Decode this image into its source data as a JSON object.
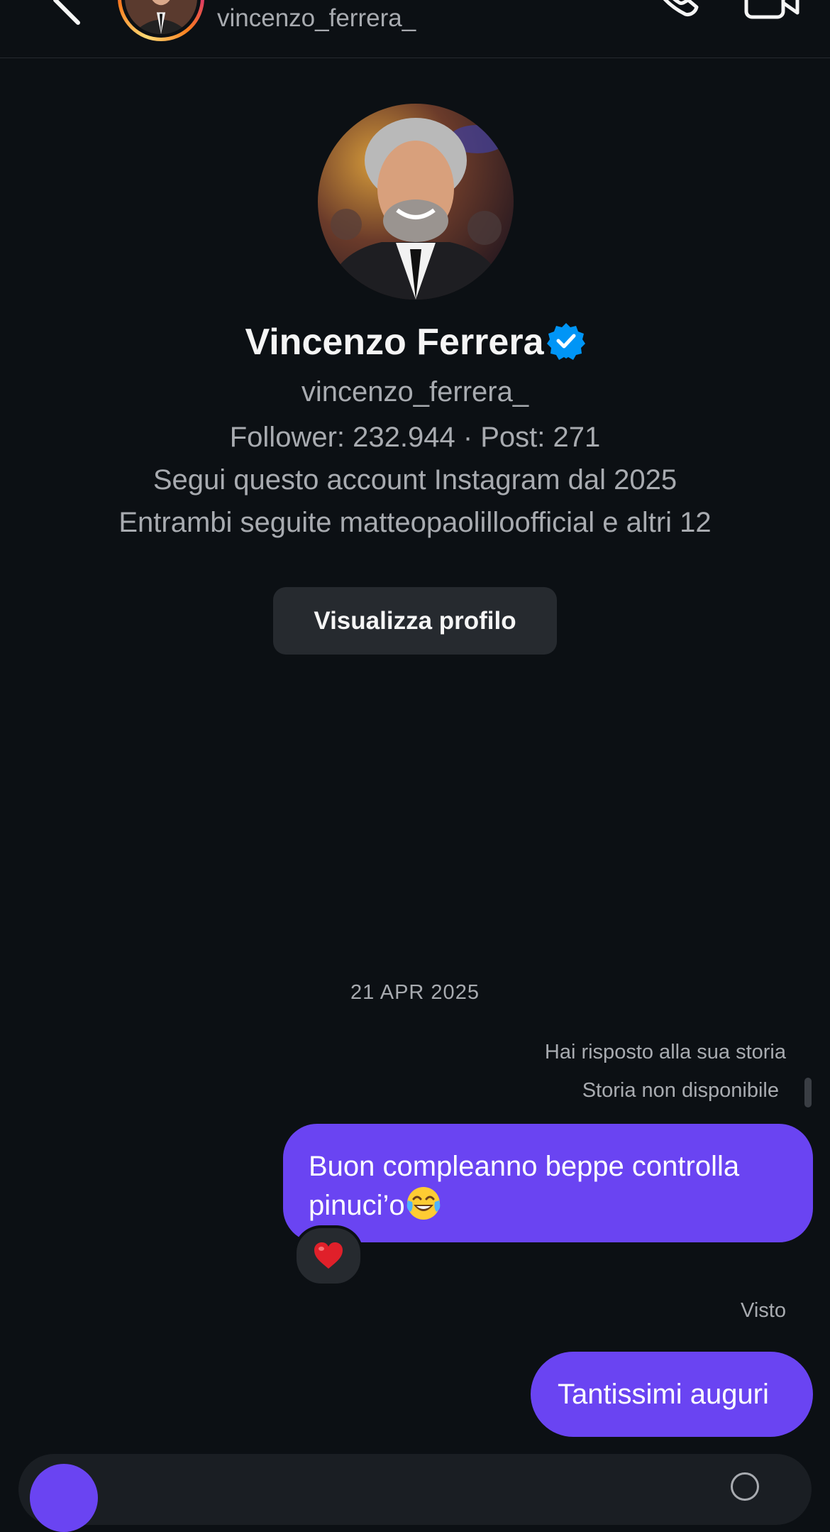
{
  "header": {
    "username": "vincenzo_ferrera_",
    "icons": {
      "back": "chevron-left-icon",
      "call": "phone-icon",
      "video": "video-camera-icon"
    }
  },
  "profile": {
    "display_name": "Vincenzo Ferrera",
    "verified": true,
    "username": "vincenzo_ferrera_",
    "stats": "Follower: 232.944 · Post: 271",
    "following_since": "Segui questo account Instagram dal 2025",
    "mutual": "Entrambi seguite matteopaolilloofficial e altri 12",
    "view_profile_label": "Visualizza profilo"
  },
  "conversation": {
    "date_separator": "21 APR 2025",
    "story_reply_note": "Hai risposto alla sua storia",
    "story_unavailable": "Storia non disponibile",
    "messages": [
      {
        "text": "Buon compleanno beppe controlla pinuci’o",
        "emoji": "face-with-tears-of-joy",
        "reaction": "red-heart"
      },
      {
        "text": "Tantissimi auguri"
      }
    ],
    "seen_label": "Visto"
  },
  "colors": {
    "background": "#0c1014",
    "bubble": "#6a44f2",
    "secondary_text": "#a8abb0",
    "button_bg": "#262a2f",
    "verified": "#0095f6"
  }
}
